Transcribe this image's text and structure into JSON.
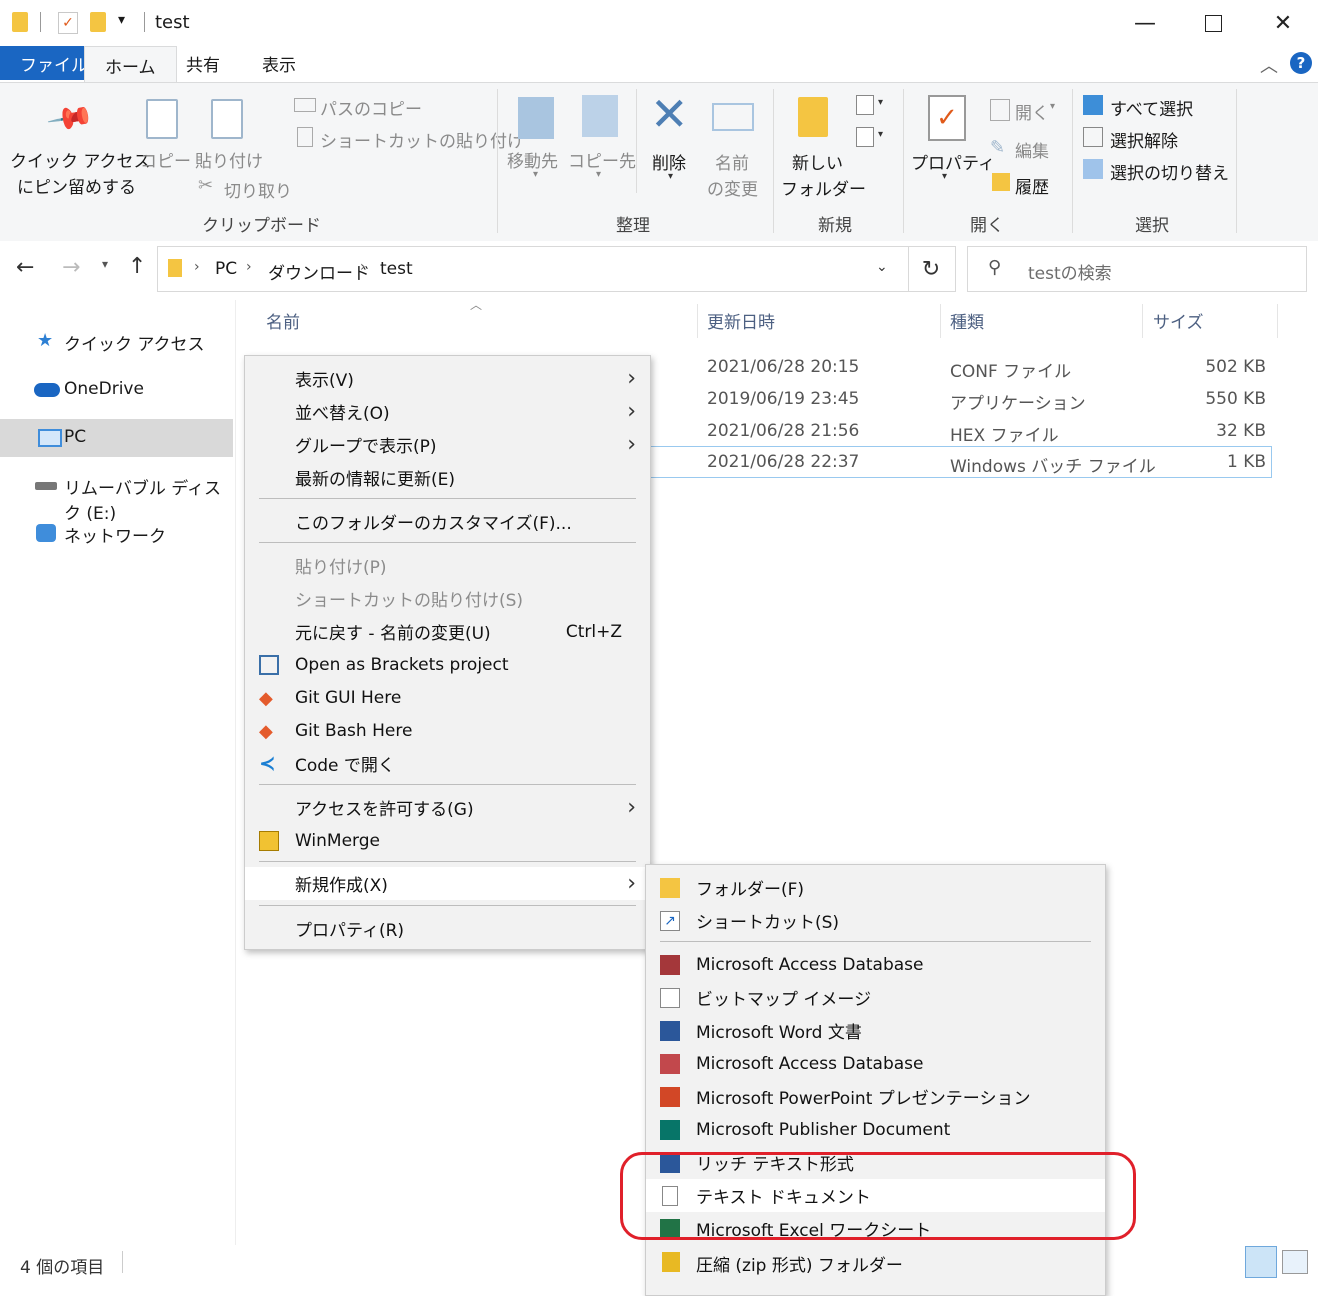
{
  "window": {
    "title": "test",
    "tabs": {
      "file": "ファイル",
      "home": "ホーム",
      "share": "共有",
      "view": "表示"
    }
  },
  "ribbon": {
    "clipboard": {
      "pin_quick_access": "クイック アクセス",
      "pin_quick_access_2": "にピン留めする",
      "copy": "コピー",
      "paste": "貼り付け",
      "copy_path": "パスのコピー",
      "paste_shortcut": "ショートカットの貼り付け",
      "cut": "切り取り",
      "group": "クリップボード"
    },
    "organize": {
      "move_to": "移動先",
      "copy_to": "コピー先",
      "delete": "削除",
      "rename_1": "名前",
      "rename_2": "の変更",
      "group": "整理"
    },
    "new": {
      "new_folder_1": "新しい",
      "new_folder_2": "フォルダー",
      "group": "新規"
    },
    "open": {
      "properties": "プロパティ",
      "open": "開く",
      "edit": "編集",
      "history": "履歴",
      "group": "開く"
    },
    "select": {
      "select_all": "すべて選択",
      "select_none": "選択解除",
      "invert": "選択の切り替え",
      "group": "選択"
    }
  },
  "address": {
    "crumbs": [
      "PC",
      "ダウンロード",
      "test"
    ],
    "search_placeholder": "testの検索"
  },
  "nav": {
    "items": [
      "クイック アクセス",
      "OneDrive",
      "PC",
      "リムーバブル ディスク (E:)",
      "ネットワーク"
    ]
  },
  "columns": {
    "name": "名前",
    "modified": "更新日時",
    "type": "種類",
    "size": "サイズ"
  },
  "files": [
    {
      "modified": "2021/06/28 20:15",
      "type": "CONF ファイル",
      "size": "502 KB"
    },
    {
      "modified": "2019/06/19 23:45",
      "type": "アプリケーション",
      "size": "550 KB"
    },
    {
      "modified": "2021/06/28 21:56",
      "type": "HEX ファイル",
      "size": "32 KB"
    },
    {
      "modified": "2021/06/28 22:37",
      "type": "Windows バッチ ファイル",
      "size": "1 KB"
    }
  ],
  "context_menu": {
    "view": "表示(V)",
    "sort": "並べ替え(O)",
    "group_by": "グループで表示(P)",
    "refresh": "最新の情報に更新(E)",
    "customize": "このフォルダーのカスタマイズ(F)...",
    "paste": "貼り付け(P)",
    "paste_shortcut": "ショートカットの貼り付け(S)",
    "undo": "元に戻す - 名前の変更(U)",
    "undo_shortcut": "Ctrl+Z",
    "brackets": "Open as Brackets project",
    "git_gui": "Git GUI Here",
    "git_bash": "Git Bash Here",
    "code": "Code で開く",
    "give_access": "アクセスを許可する(G)",
    "winmerge": "WinMerge",
    "new": "新規作成(X)",
    "properties": "プロパティ(R)"
  },
  "submenu": {
    "folder": "フォルダー(F)",
    "shortcut": "ショートカット(S)",
    "access1": "Microsoft Access Database",
    "bitmap": "ビットマップ イメージ",
    "word": "Microsoft Word 文書",
    "access2": "Microsoft Access Database",
    "powerpoint": "Microsoft PowerPoint プレゼンテーション",
    "publisher": "Microsoft Publisher Document",
    "rtf": "リッチ テキスト形式",
    "text": "テキスト ドキュメント",
    "excel": "Microsoft Excel ワークシート",
    "zip": "圧縮 (zip 形式) フォルダー"
  },
  "status": {
    "count": "4 個の項目"
  },
  "colors": {
    "accent": "#1a66c2",
    "highlight_circle": "#e0202a",
    "folder": "#f4c542"
  }
}
